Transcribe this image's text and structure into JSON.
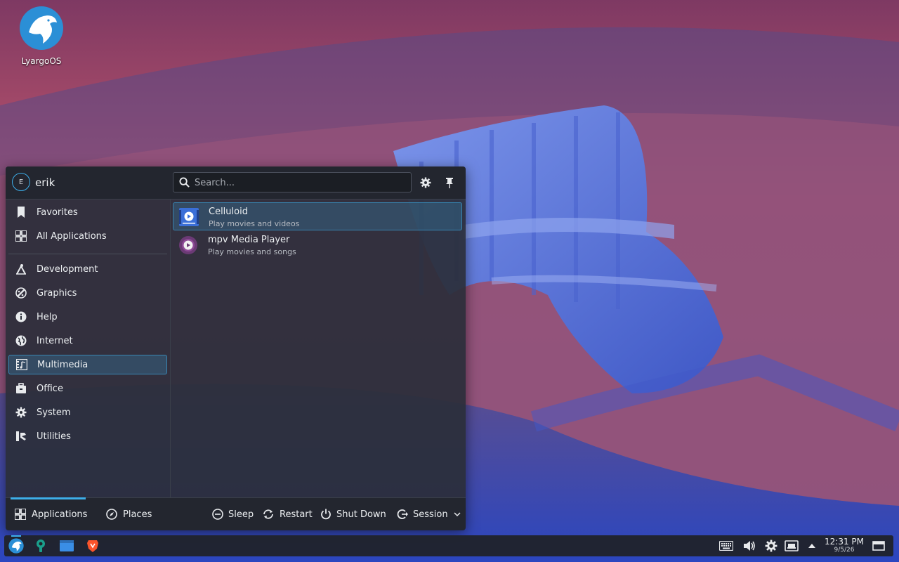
{
  "desktop": {
    "icon_label": "LyargoOS"
  },
  "menu": {
    "user": {
      "initial": "E",
      "name": "erik"
    },
    "search": {
      "placeholder": "Search...",
      "value": ""
    },
    "categories": [
      {
        "label": "Favorites",
        "icon": "bookmark-icon"
      },
      {
        "label": "All Applications",
        "icon": "grid-icon"
      },
      {
        "label": "Development",
        "icon": "development-icon"
      },
      {
        "label": "Graphics",
        "icon": "graphics-icon"
      },
      {
        "label": "Help",
        "icon": "info-icon"
      },
      {
        "label": "Internet",
        "icon": "globe-icon"
      },
      {
        "label": "Multimedia",
        "icon": "multimedia-icon",
        "selected": true
      },
      {
        "label": "Office",
        "icon": "office-icon"
      },
      {
        "label": "System",
        "icon": "gear-icon"
      },
      {
        "label": "Utilities",
        "icon": "utilities-icon"
      }
    ],
    "apps": [
      {
        "name": "Celluloid",
        "description": "Play movies and videos",
        "selected": true
      },
      {
        "name": "mpv Media Player",
        "description": "Play movies and songs"
      }
    ],
    "footer": {
      "tabs": [
        {
          "label": "Applications",
          "active": true
        },
        {
          "label": "Places"
        }
      ],
      "actions": [
        {
          "label": "Sleep"
        },
        {
          "label": "Restart"
        },
        {
          "label": "Shut Down"
        },
        {
          "label": "Session"
        }
      ]
    }
  },
  "taskbar": {
    "clock": {
      "time": "12:31 PM",
      "date": "9/5/26"
    }
  },
  "colors": {
    "accent": "#3daee9",
    "panel": "#20232a"
  }
}
